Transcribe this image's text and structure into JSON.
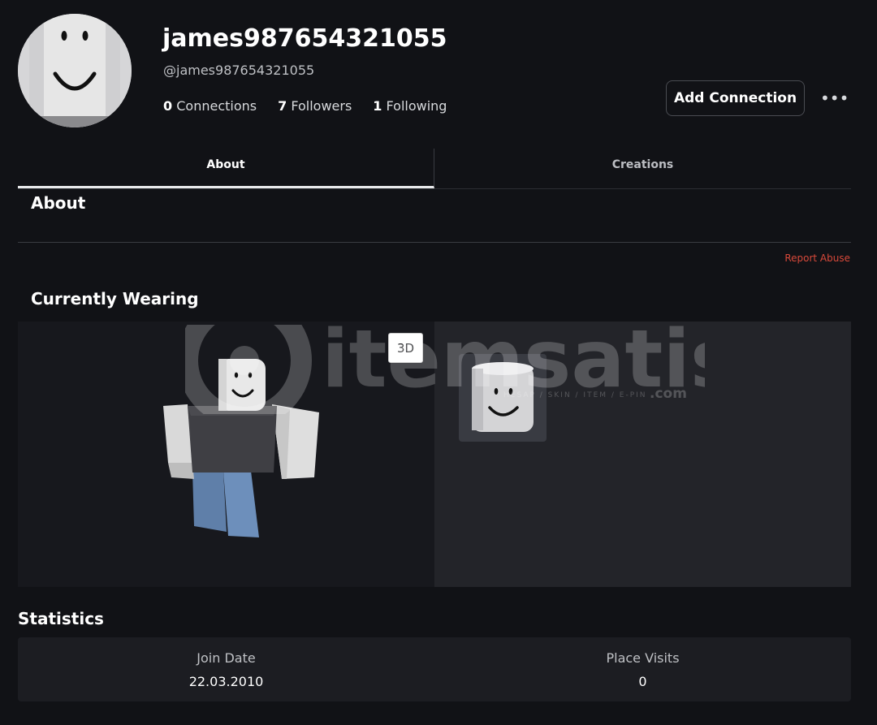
{
  "profile": {
    "display_name": "james987654321055",
    "handle": "@james987654321055",
    "connections_count": "0",
    "connections_label": "Connections",
    "followers_count": "7",
    "followers_label": "Followers",
    "following_count": "1",
    "following_label": "Following"
  },
  "actions": {
    "add_connection_label": "Add Connection",
    "more_label": "•••"
  },
  "tabs": [
    {
      "label": "About",
      "active": true
    },
    {
      "label": "Creations",
      "active": false
    }
  ],
  "about": {
    "heading": "About",
    "report_label": "Report Abuse"
  },
  "wearing": {
    "heading": "Currently Wearing",
    "view_toggle_label": "3D"
  },
  "watermark": {
    "brand": "itemsatis",
    "tagline": "HESAP / SKIN / ITEM / E-PIN",
    "suffix": ".com"
  },
  "statistics": {
    "heading": "Statistics",
    "join_date_label": "Join Date",
    "join_date_value": "22.03.2010",
    "place_visits_label": "Place Visits",
    "place_visits_value": "0"
  },
  "colors": {
    "background": "#111216",
    "report_abuse": "#d8493a",
    "panel_left": "#17181d",
    "panel_right": "#232429"
  }
}
